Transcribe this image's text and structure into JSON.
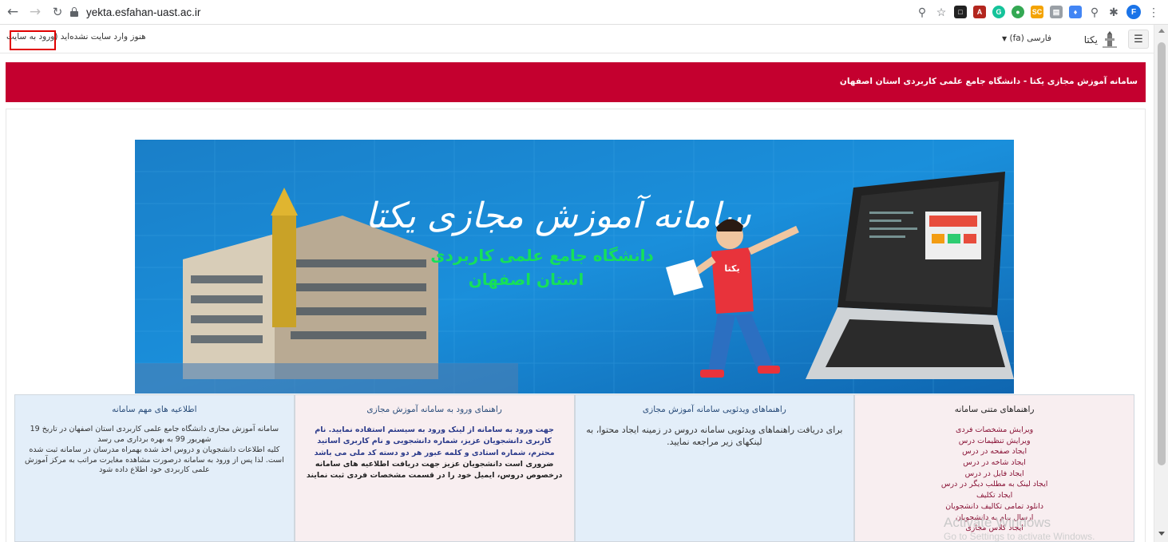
{
  "browser": {
    "url": "yekta.esfahan-uast.ac.ir",
    "extensions": [
      "zoom-icon",
      "star-icon",
      "clapper-icon",
      "pdf-icon",
      "grammarly-icon",
      "chrome-icon",
      "sc-icon",
      "docs-icon",
      "puzzle-color-icon",
      "pin-icon",
      "puzzle-icon"
    ],
    "profile_initial": "F"
  },
  "navbar": {
    "not_logged_in": "هنوز وارد سایت نشده‌اید",
    "login_link": "(ورود به سایت",
    "language": "فارسی (fa)",
    "site_name": "یکتا",
    "menu_icon": "hamburger-icon"
  },
  "header": {
    "title": "سامانه آموزش مجازی یکتا - دانشگاه جامع علمی کاربردی استان اصفهان",
    "color": "#c4002f"
  },
  "banner": {
    "title": "سامانه آموزش مجازی یکتا",
    "subtitle1": "دانشگاه جامع علمی کاربردی",
    "subtitle2": "استان اصفهان",
    "shirt_text": "یکتا"
  },
  "columns": {
    "guides": {
      "title": "راهنماهای متنی سامانه",
      "links": [
        "ویرایش مشخصات فردی",
        "ویرایش تنظیمات درس",
        "ایجاد صفحه در درس",
        "ایجاد شاخه در درس",
        "ایجاد فایل در درس",
        "ایجاد لینک به مطلب دیگر در درس",
        "ایجاد تکلیف",
        "دانلود تمامی تکالیف دانشجویان",
        "ارسال پیام به دانشجویان",
        "ایجاد کلاس مجازی"
      ]
    },
    "videos": {
      "title": "راهنماهای ویدئویی سامانه آموزش مجازی",
      "text": "برای دریافت راهنماهای ویدئویی سامانه دروس در زمینه ایجاد محتوا، به لینکهای زیر مراجعه نمایید."
    },
    "login_guide": {
      "title": "راهنمای ورود به سامانه آموزش مجازی",
      "bold1": "جهت ورود به سامانه از لینک ورود به سیستم استفاده نمایید. نام کاربری دانشجویان عزیز، شماره دانشجویی و نام کاربری اساتید محترم، شماره استادی و کلمه عبور هر دو دسته کد ملی می باشد",
      "bold2": "ضروری است دانشجویان عزیز جهت دریافت اطلاعیه های سامانه درخصوص دروس، ایمیل خود را در قسمت مشخصات فردی ثبت نمایند"
    },
    "announcements": {
      "title": "اطلاعیه های مهم سامانه",
      "text1": "سامانه آموزش مجازی دانشگاه جامع علمی کاربردی استان اصفهان در تاریخ 19 شهریور 99 به بهره برداری می رسد",
      "text2": "کلیه اطلاعات دانشجویان و دروس اخذ شده بهمراه مدرسان در سامانه ثبت شده است. لذا پس از ورود به سامانه درصورت مشاهده مغایرت مراتب به مرکز آموزش علمی کاربردی خود اطلاع داده شود"
    }
  },
  "watermark": {
    "line1": "Activate Windows",
    "line2": "Go to Settings to activate Windows."
  }
}
